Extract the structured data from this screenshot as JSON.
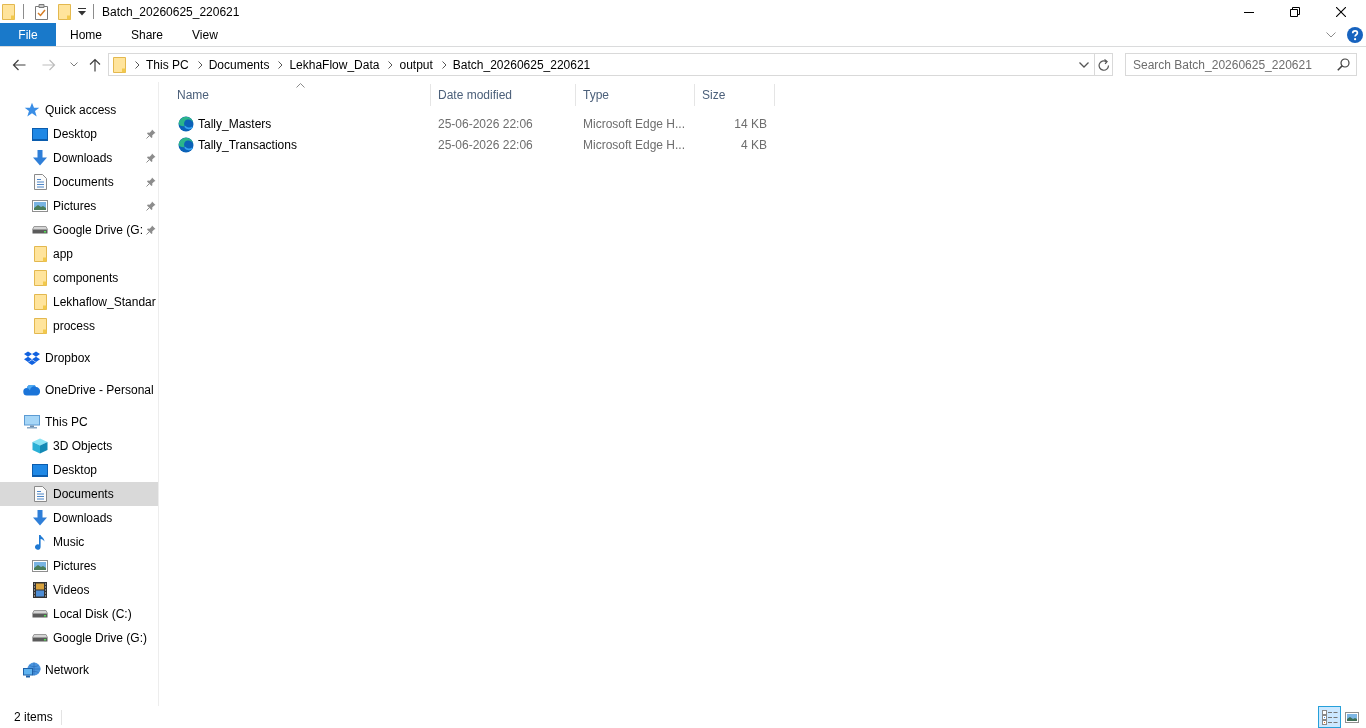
{
  "window": {
    "title": "Batch_20260625_220621"
  },
  "ribbon": {
    "tabs": [
      {
        "label": "File",
        "kind": "menu",
        "selected": false
      },
      {
        "label": "Home",
        "kind": "tab",
        "selected": false
      },
      {
        "label": "Share",
        "kind": "tab",
        "selected": false
      },
      {
        "label": "View",
        "kind": "tab",
        "selected": false
      }
    ],
    "expanded": false
  },
  "address_bar": {
    "path": [
      "This PC",
      "Documents",
      "LekhaFlow_Data",
      "output",
      "Batch_20260625_220621"
    ]
  },
  "search": {
    "placeholder": "Search Batch_20260625_220621"
  },
  "navigation_pane": {
    "items": [
      {
        "label": "Quick access",
        "kind": "star",
        "selected": false,
        "children": [
          {
            "label": "Desktop",
            "kind": "desktop",
            "pinned": true,
            "selected": false
          },
          {
            "label": "Downloads",
            "kind": "downloads",
            "pinned": true,
            "selected": false
          },
          {
            "label": "Documents",
            "kind": "documents",
            "pinned": true,
            "selected": false
          },
          {
            "label": "Pictures",
            "kind": "pictures",
            "pinned": true,
            "selected": false
          },
          {
            "label": "Google Drive (G:",
            "kind": "drive",
            "pinned": true,
            "selected": false
          },
          {
            "label": "app",
            "kind": "folder",
            "pinned": false,
            "selected": false
          },
          {
            "label": "components",
            "kind": "folder",
            "pinned": false,
            "selected": false
          },
          {
            "label": "Lekhaflow_Standar",
            "kind": "folder",
            "pinned": false,
            "selected": false
          },
          {
            "label": "process",
            "kind": "folder",
            "pinned": false,
            "selected": false
          }
        ]
      },
      {
        "label": "Dropbox",
        "kind": "dropbox",
        "selected": false
      },
      {
        "label": "OneDrive - Personal",
        "kind": "cloud",
        "selected": false
      },
      {
        "label": "This PC",
        "kind": "computer",
        "selected": false,
        "children": [
          {
            "label": "3D Objects",
            "kind": "cube",
            "selected": false
          },
          {
            "label": "Desktop",
            "kind": "desktop",
            "selected": false
          },
          {
            "label": "Documents",
            "kind": "documents",
            "selected": true
          },
          {
            "label": "Downloads",
            "kind": "downloads",
            "selected": false
          },
          {
            "label": "Music",
            "kind": "music",
            "selected": false
          },
          {
            "label": "Pictures",
            "kind": "pictures",
            "selected": false
          },
          {
            "label": "Videos",
            "kind": "videos",
            "selected": false
          },
          {
            "label": "Local Disk (C:)",
            "kind": "drive",
            "selected": false
          },
          {
            "label": "Google Drive (G:)",
            "kind": "drive",
            "selected": false
          }
        ]
      },
      {
        "label": "Network",
        "kind": "network",
        "selected": false
      }
    ]
  },
  "file_list": {
    "columns": [
      {
        "label": "Name",
        "sorted": true
      },
      {
        "label": "Date modified",
        "sorted": false
      },
      {
        "label": "Type",
        "sorted": false
      },
      {
        "label": "Size",
        "sorted": false
      }
    ],
    "rows": [
      {
        "name": "Tally_Masters",
        "date_modified": "25-06-2026 22:06",
        "type": "Microsoft Edge H...",
        "size": "14 KB",
        "selected": false
      },
      {
        "name": "Tally_Transactions",
        "date_modified": "25-06-2026 22:06",
        "type": "Microsoft Edge H...",
        "size": "4 KB",
        "selected": false
      }
    ]
  },
  "status_bar": {
    "item_count": "2 items",
    "views": [
      {
        "kind": "details",
        "selected": true
      },
      {
        "kind": "large_icons",
        "selected": false
      }
    ]
  }
}
